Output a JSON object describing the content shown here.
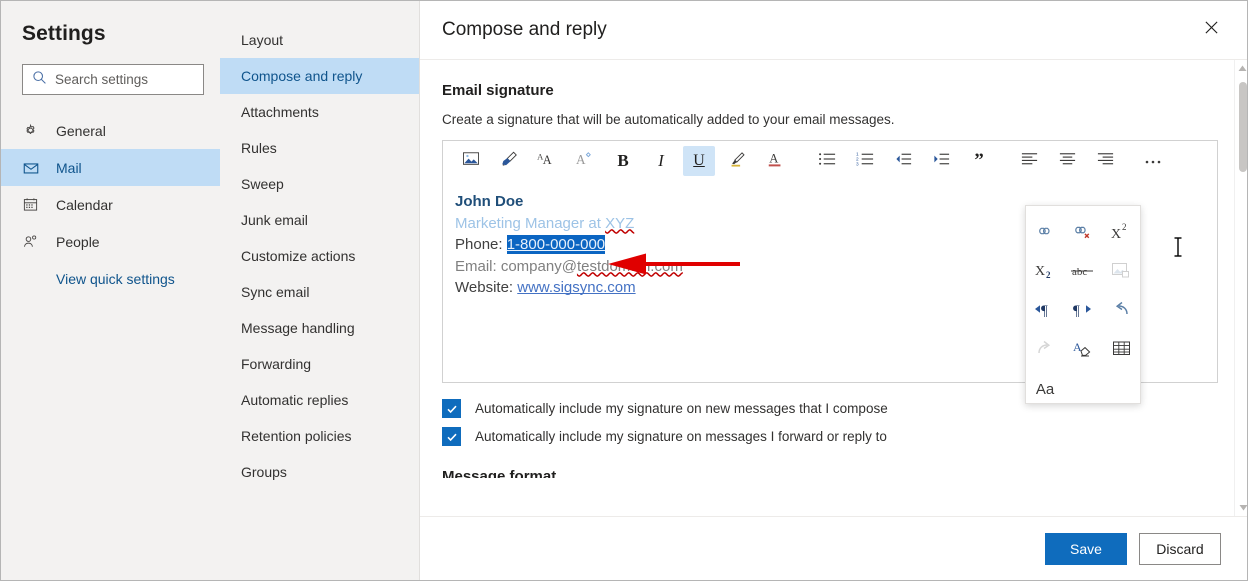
{
  "settings": {
    "title": "Settings",
    "search": {
      "placeholder": "Search settings",
      "value": "",
      "icon": "search-icon"
    },
    "items": [
      {
        "label": "General",
        "icon": "gear-icon",
        "selected": false
      },
      {
        "label": "Mail",
        "icon": "envelope-icon",
        "selected": true
      },
      {
        "label": "Calendar",
        "icon": "calendar-icon",
        "selected": false
      },
      {
        "label": "People",
        "icon": "person-icon",
        "selected": false
      }
    ],
    "quick_settings_label": "View quick settings"
  },
  "subnav": {
    "items": [
      {
        "label": "Layout",
        "selected": false
      },
      {
        "label": "Compose and reply",
        "selected": true
      },
      {
        "label": "Attachments",
        "selected": false
      },
      {
        "label": "Rules",
        "selected": false
      },
      {
        "label": "Sweep",
        "selected": false
      },
      {
        "label": "Junk email",
        "selected": false
      },
      {
        "label": "Customize actions",
        "selected": false
      },
      {
        "label": "Sync email",
        "selected": false
      },
      {
        "label": "Message handling",
        "selected": false
      },
      {
        "label": "Forwarding",
        "selected": false
      },
      {
        "label": "Automatic replies",
        "selected": false
      },
      {
        "label": "Retention policies",
        "selected": false
      },
      {
        "label": "Groups",
        "selected": false
      }
    ]
  },
  "detail": {
    "title": "Compose and reply",
    "close_icon": "close-icon",
    "section": {
      "title": "Email signature",
      "description": "Create a signature that will be automatically added to your email messages."
    },
    "toolbar": {
      "buttons": [
        {
          "name": "insert-picture-icon",
          "glyph": "picture",
          "active": false
        },
        {
          "name": "format-painter-icon",
          "glyph": "painter",
          "active": false
        },
        {
          "name": "font-size-icon",
          "glyph": "AA",
          "active": false
        },
        {
          "name": "font-color-icon",
          "glyph": "Acaret",
          "active": false
        },
        {
          "name": "bold-icon",
          "glyph": "B",
          "active": false
        },
        {
          "name": "italic-icon",
          "glyph": "I",
          "active": false
        },
        {
          "name": "underline-icon",
          "glyph": "U",
          "active": true
        },
        {
          "name": "highlight-icon",
          "glyph": "pen",
          "active": false
        },
        {
          "name": "font-color-a-icon",
          "glyph": "Aunder",
          "active": false
        },
        {
          "name": "bulleted-list-icon",
          "glyph": "bullets",
          "active": false
        },
        {
          "name": "numbered-list-icon",
          "glyph": "numbers",
          "active": false
        },
        {
          "name": "decrease-indent-icon",
          "glyph": "outdent",
          "active": false
        },
        {
          "name": "increase-indent-icon",
          "glyph": "indent",
          "active": false
        },
        {
          "name": "quote-icon",
          "glyph": "quote",
          "active": false
        },
        {
          "name": "align-left-icon",
          "glyph": "alignleft",
          "active": false
        },
        {
          "name": "align-center-icon",
          "glyph": "aligncenter",
          "active": false
        },
        {
          "name": "align-right-icon",
          "glyph": "alignright",
          "active": false
        },
        {
          "name": "more-options-icon",
          "glyph": "ellipsis",
          "active": false
        }
      ]
    },
    "signature": {
      "name": "John Doe",
      "role_prefix": "Marketing Manager at ",
      "role_company": "XYZ",
      "phone_label": "Phone: ",
      "phone_value": "1-800-000-000",
      "email_label": "Email: ",
      "email_user": "company@",
      "email_domain": "testdomain.com",
      "website_label": "Website: ",
      "website_value": "www.sigsync.com"
    },
    "context_menu": {
      "items": [
        {
          "name": "insert-link-icon",
          "disabled": false
        },
        {
          "name": "remove-link-icon",
          "disabled": false
        },
        {
          "name": "superscript-icon",
          "disabled": false
        },
        {
          "name": "subscript-icon",
          "disabled": false
        },
        {
          "name": "strikethrough-icon",
          "disabled": false
        },
        {
          "name": "insert-image-icon",
          "disabled": true
        },
        {
          "name": "text-direction-ltr-icon",
          "disabled": false
        },
        {
          "name": "text-direction-rtl-icon",
          "disabled": false
        },
        {
          "name": "undo-icon",
          "disabled": false
        },
        {
          "name": "redo-icon",
          "disabled": true
        },
        {
          "name": "clear-formatting-icon",
          "disabled": false
        },
        {
          "name": "insert-table-icon",
          "disabled": false
        }
      ],
      "change_case_label": "Aa"
    },
    "checkboxes": [
      {
        "label": "Automatically include my signature on new messages that I compose",
        "checked": true
      },
      {
        "label": "Automatically include my signature on messages I forward or reply to",
        "checked": true
      }
    ],
    "next_section_title": "Message format",
    "footer": {
      "save_label": "Save",
      "discard_label": "Discard"
    }
  },
  "annotation": {
    "arrow_color": "#e00000",
    "direction": "left"
  },
  "colors": {
    "accent": "#0f6cbd",
    "selected_nav": "#bfdcf5",
    "selected_nav_text": "#0f548c",
    "pane_bg": "#f3f2f1",
    "selection_blue": "#0b65c2"
  }
}
